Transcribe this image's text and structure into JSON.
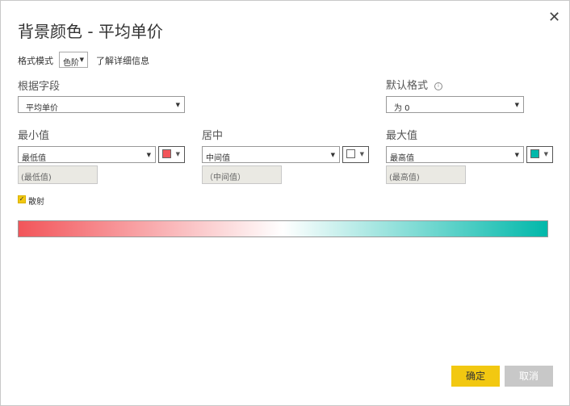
{
  "dialog": {
    "title": "背景颜色 - 平均单价",
    "close_glyph": "✕"
  },
  "format_mode": {
    "label": "格式模式",
    "value": "色阶",
    "learn_more": "了解详细信息"
  },
  "field": {
    "heading": "根据字段",
    "value": "平均单价"
  },
  "default_format": {
    "heading": "默认格式",
    "value": "为 0"
  },
  "minimum": {
    "heading": "最小值",
    "type": "最低值",
    "input_placeholder": "(最低值)",
    "color": "#f2555a"
  },
  "center": {
    "heading": "居中",
    "type": "中间值",
    "input_placeholder": "（中间值）",
    "color": "#ffffff"
  },
  "maximum": {
    "heading": "最大值",
    "type": "最高值",
    "input_placeholder": "(最高值)",
    "color": "#01b8aa"
  },
  "diverging": {
    "label": "散射",
    "checked": true
  },
  "buttons": {
    "ok": "确定",
    "cancel": "取消"
  }
}
